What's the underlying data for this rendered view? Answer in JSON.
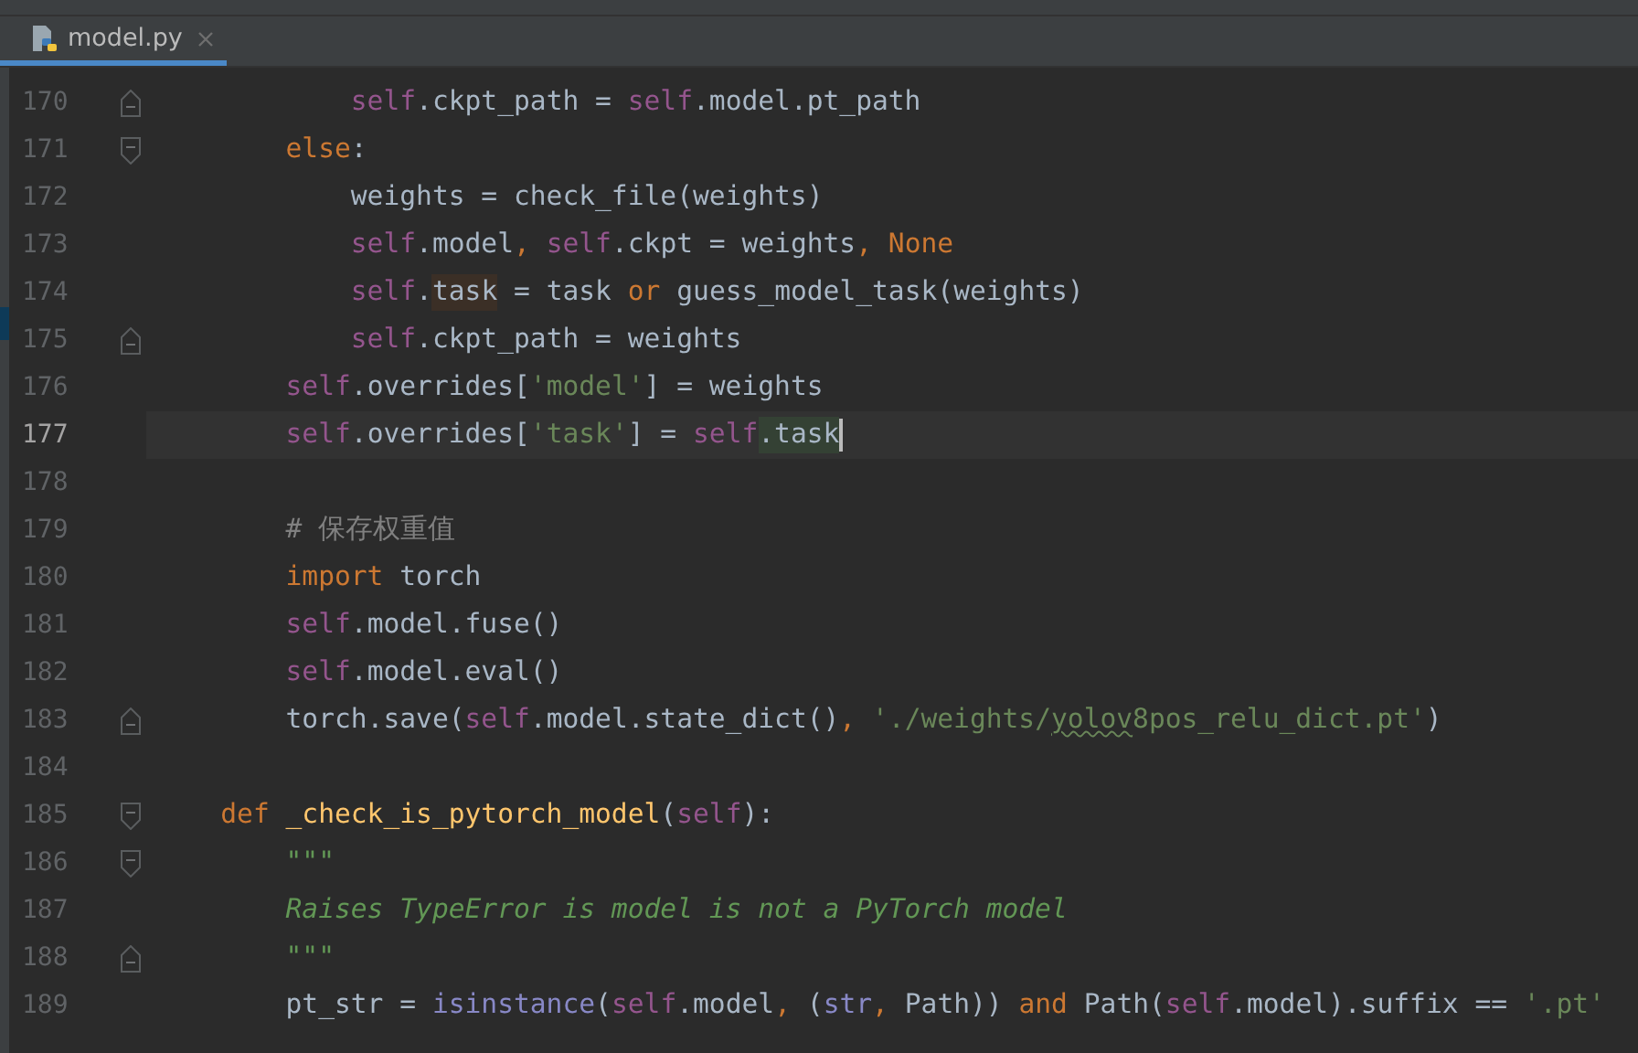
{
  "tabs": [
    {
      "label": "model.py",
      "selected": true
    }
  ],
  "lines": [
    {
      "number": "170",
      "current": false,
      "fold_start": false,
      "fold_end": true,
      "tokens": [
        {
          "kind": "self",
          "text": "            self"
        },
        {
          "kind": "plain",
          "text": ".ckpt_path = "
        },
        {
          "kind": "self",
          "text": "self"
        },
        {
          "kind": "plain",
          "text": ".model.pt_path"
        }
      ]
    },
    {
      "number": "171",
      "current": false,
      "fold_start": true,
      "fold_end": false,
      "tokens": [
        {
          "kind": "kw",
          "text": "        else"
        },
        {
          "kind": "plain",
          "text": ":"
        }
      ]
    },
    {
      "number": "172",
      "current": false,
      "tokens": [
        {
          "kind": "plain",
          "text": "            weights = check_file(weights)"
        }
      ]
    },
    {
      "number": "173",
      "current": false,
      "tokens": [
        {
          "kind": "self",
          "text": "            self"
        },
        {
          "kind": "plain",
          "text": ".model"
        },
        {
          "kind": "kw",
          "text": ", "
        },
        {
          "kind": "self",
          "text": "self"
        },
        {
          "kind": "plain",
          "text": ".ckpt = weights"
        },
        {
          "kind": "kw",
          "text": ", None"
        }
      ]
    },
    {
      "number": "174",
      "current": false,
      "tokens": [
        {
          "kind": "self",
          "text": "            self"
        },
        {
          "kind": "plain",
          "text": "."
        },
        {
          "kind": "usage",
          "text": "task"
        },
        {
          "kind": "plain",
          "text": " = task "
        },
        {
          "kind": "kw",
          "text": "or"
        },
        {
          "kind": "plain",
          "text": " guess_model_task(weights)"
        }
      ]
    },
    {
      "number": "175",
      "current": false,
      "fold_start": false,
      "fold_end": true,
      "tokens": [
        {
          "kind": "self",
          "text": "            self"
        },
        {
          "kind": "plain",
          "text": ".ckpt_path = weights"
        }
      ]
    },
    {
      "number": "176",
      "current": false,
      "tokens": [
        {
          "kind": "self",
          "text": "        self"
        },
        {
          "kind": "plain",
          "text": ".overrides["
        },
        {
          "kind": "str",
          "text": "'model'"
        },
        {
          "kind": "plain",
          "text": "] = weights"
        }
      ]
    },
    {
      "number": "177",
      "current": true,
      "caret": true,
      "tokens": [
        {
          "kind": "self",
          "text": "        self"
        },
        {
          "kind": "plain",
          "text": ".overrides["
        },
        {
          "kind": "str",
          "text": "'task'"
        },
        {
          "kind": "plain",
          "text": "] = "
        },
        {
          "kind": "self",
          "text": "self"
        },
        {
          "kind": "write",
          "text": ".task"
        }
      ]
    },
    {
      "number": "178",
      "current": false
    },
    {
      "number": "179",
      "current": false,
      "tokens": [
        {
          "kind": "comment",
          "text": "        # 保存权重值"
        }
      ]
    },
    {
      "number": "180",
      "current": false,
      "tokens": [
        {
          "kind": "kw",
          "text": "        import"
        },
        {
          "kind": "plain",
          "text": " torch"
        }
      ]
    },
    {
      "number": "181",
      "current": false,
      "tokens": [
        {
          "kind": "self",
          "text": "        self"
        },
        {
          "kind": "plain",
          "text": ".model.fuse()"
        }
      ]
    },
    {
      "number": "182",
      "current": false,
      "tokens": [
        {
          "kind": "self",
          "text": "        self"
        },
        {
          "kind": "plain",
          "text": ".model.eval()"
        }
      ]
    },
    {
      "number": "183",
      "current": false,
      "fold_start": false,
      "fold_end": true,
      "tokens": [
        {
          "kind": "plain",
          "text": "        torch.save("
        },
        {
          "kind": "self",
          "text": "self"
        },
        {
          "kind": "plain",
          "text": ".model.state_dict()"
        },
        {
          "kind": "kw",
          "text": ", "
        },
        {
          "kind": "str",
          "text": "'./weights/"
        },
        {
          "kind": "typo",
          "text": "yolov"
        },
        {
          "kind": "str",
          "text": "8pos_relu_dict.pt'"
        },
        {
          "kind": "plain",
          "text": ")"
        }
      ]
    },
    {
      "number": "184",
      "current": false
    },
    {
      "number": "185",
      "current": false,
      "fold_start": true,
      "fold_end": false,
      "tokens": [
        {
          "kind": "kw",
          "text": "    def"
        },
        {
          "kind": "defname",
          "text": " _check_is_pytorch_model"
        },
        {
          "kind": "plain",
          "text": "("
        },
        {
          "kind": "self",
          "text": "self"
        },
        {
          "kind": "plain",
          "text": "):"
        }
      ]
    },
    {
      "number": "186",
      "current": false,
      "fold_start": true,
      "fold_end": false,
      "tokens": [
        {
          "kind": "doc",
          "text": "        \"\"\""
        }
      ]
    },
    {
      "number": "187",
      "current": false,
      "tokens": [
        {
          "kind": "doc",
          "text": "        Raises TypeError is model is not a PyTorch model"
        }
      ]
    },
    {
      "number": "188",
      "current": false,
      "fold_start": false,
      "fold_end": true,
      "tokens": [
        {
          "kind": "doc",
          "text": "        \"\"\""
        }
      ]
    },
    {
      "number": "189",
      "current": false,
      "tokens": [
        {
          "kind": "plain",
          "text": "        pt_str = "
        },
        {
          "kind": "builtin",
          "text": "isinstance"
        },
        {
          "kind": "plain",
          "text": "("
        },
        {
          "kind": "self",
          "text": "self"
        },
        {
          "kind": "plain",
          "text": ".model"
        },
        {
          "kind": "kw",
          "text": ", "
        },
        {
          "kind": "plain",
          "text": "("
        },
        {
          "kind": "builtin",
          "text": "str"
        },
        {
          "kind": "kw",
          "text": ", "
        },
        {
          "kind": "plain",
          "text": "Path)) "
        },
        {
          "kind": "kw",
          "text": "and"
        },
        {
          "kind": "plain",
          "text": " Path("
        },
        {
          "kind": "self",
          "text": "self"
        },
        {
          "kind": "plain",
          "text": ".model).suffix == "
        },
        {
          "kind": "str",
          "text": "'.pt'"
        }
      ]
    }
  ]
}
